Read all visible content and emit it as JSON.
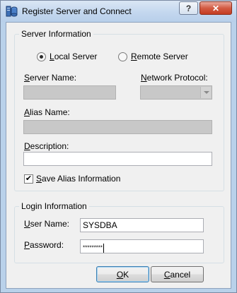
{
  "window": {
    "title": "Register Server and Connect",
    "icon": "server-db-icon",
    "help_label": "?",
    "close_label": "✕"
  },
  "server_info": {
    "legend": "Server Information",
    "radio_local": {
      "label": "Local Server",
      "checked": true
    },
    "radio_remote": {
      "label": "Remote Server",
      "checked": false
    },
    "server_name_label": "Server Name:",
    "server_name_value": "",
    "network_protocol_label": "Network Protocol:",
    "network_protocol_value": "",
    "alias_name_label": "Alias Name:",
    "alias_name_value": "",
    "description_label": "Description:",
    "description_value": "",
    "save_alias_label": "Save Alias Information",
    "save_alias_checked": true
  },
  "login_info": {
    "legend": "Login Information",
    "user_name_label": "User Name:",
    "user_name_value": "SYSDBA",
    "password_label": "Password:",
    "password_value": "*********"
  },
  "buttons": {
    "ok_label": "OK",
    "cancel_label": "Cancel"
  },
  "colors": {
    "close_button": "#c43c22",
    "titlebar": "#c2d6ee",
    "disabled_field": "#c8c8c8"
  }
}
